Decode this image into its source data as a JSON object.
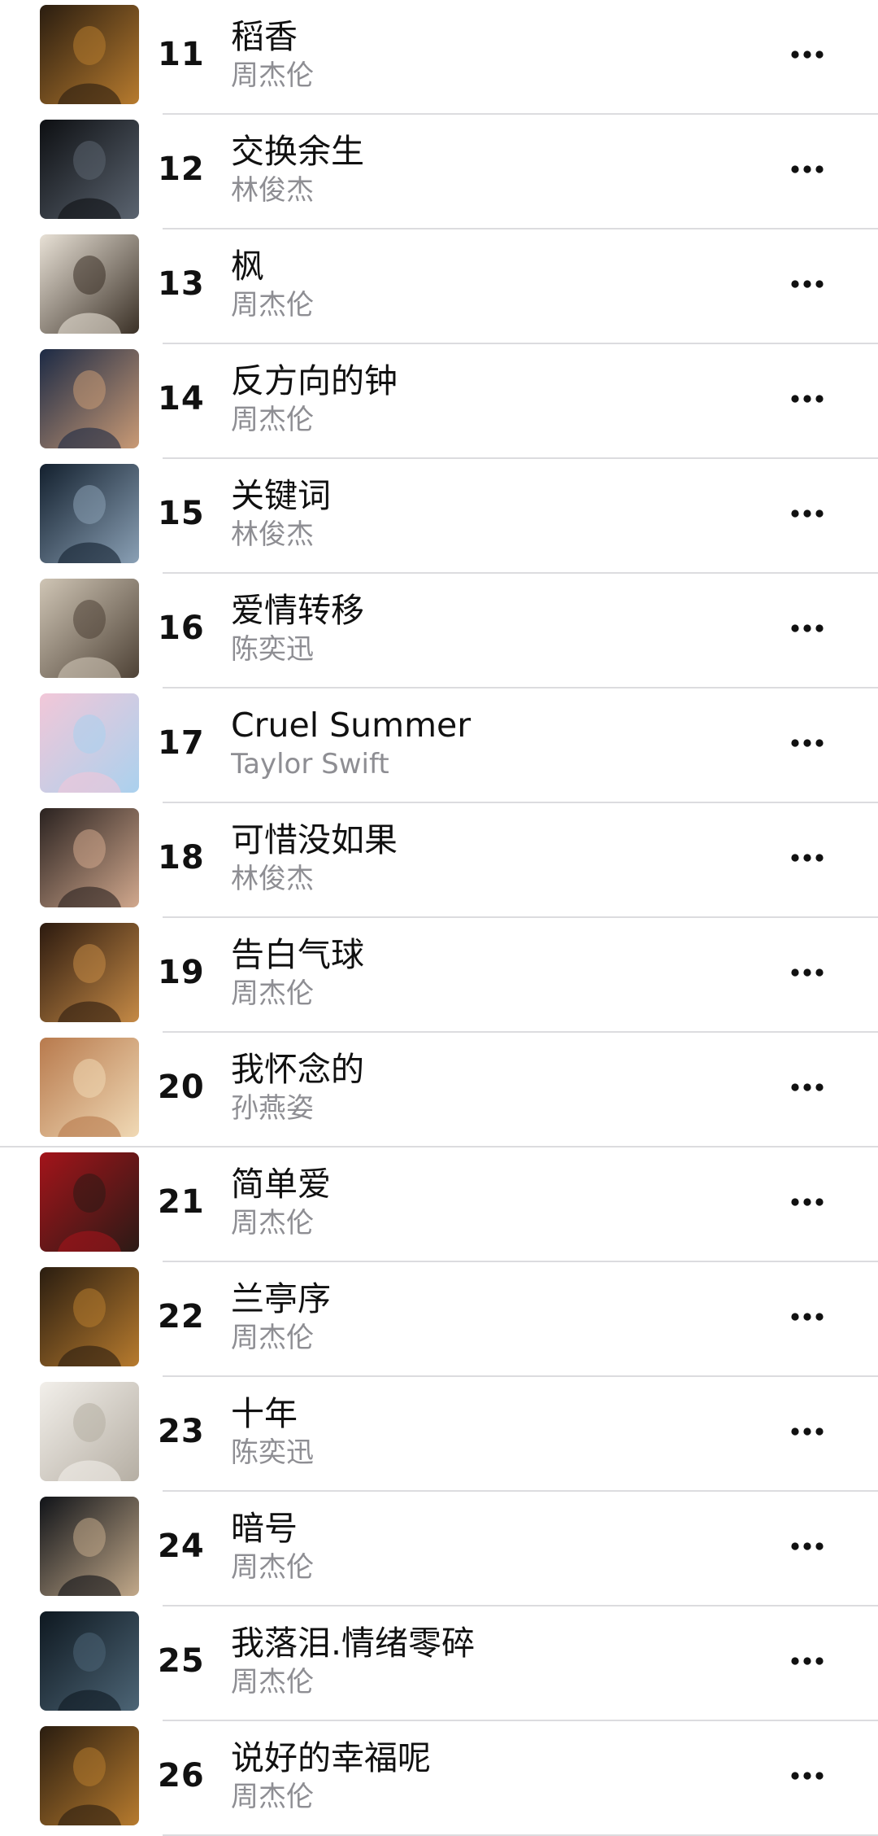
{
  "songs": [
    {
      "rank": "11",
      "title": "稻香",
      "artist": "周杰伦",
      "art_colors": [
        "#2a1d10",
        "#b77b2e"
      ]
    },
    {
      "rank": "12",
      "title": "交换余生",
      "artist": "林俊杰",
      "art_colors": [
        "#0d0f12",
        "#5b6470"
      ]
    },
    {
      "rank": "13",
      "title": "枫",
      "artist": "周杰伦",
      "art_colors": [
        "#e8e1d6",
        "#3a3026"
      ]
    },
    {
      "rank": "14",
      "title": "反方向的钟",
      "artist": "周杰伦",
      "art_colors": [
        "#1c2a45",
        "#c99a75"
      ]
    },
    {
      "rank": "15",
      "title": "关键词",
      "artist": "林俊杰",
      "art_colors": [
        "#13202e",
        "#8aa0b5"
      ]
    },
    {
      "rank": "16",
      "title": "爱情转移",
      "artist": "陈奕迅",
      "art_colors": [
        "#cfc5b5",
        "#4e4236"
      ]
    },
    {
      "rank": "17",
      "title": "Cruel Summer",
      "artist": "Taylor Swift",
      "art_colors": [
        "#f2c7d8",
        "#aad1ee"
      ]
    },
    {
      "rank": "18",
      "title": "可惜没如果",
      "artist": "林俊杰",
      "art_colors": [
        "#2a2220",
        "#d1a88d"
      ]
    },
    {
      "rank": "19",
      "title": "告白气球",
      "artist": "周杰伦",
      "art_colors": [
        "#2c1a0f",
        "#c58a46"
      ]
    },
    {
      "rank": "20",
      "title": "我怀念的",
      "artist": "孙燕姿",
      "art_colors": [
        "#b87a4d",
        "#f0d9b5"
      ]
    },
    {
      "rank": "21",
      "title": "简单爱",
      "artist": "周杰伦",
      "art_colors": [
        "#a3141a",
        "#2b1a16"
      ]
    },
    {
      "rank": "22",
      "title": "兰亭序",
      "artist": "周杰伦",
      "art_colors": [
        "#2a1d10",
        "#b77b2e"
      ]
    },
    {
      "rank": "23",
      "title": "十年",
      "artist": "陈奕迅",
      "art_colors": [
        "#f2efea",
        "#b5aea3"
      ]
    },
    {
      "rank": "24",
      "title": "暗号",
      "artist": "周杰伦",
      "art_colors": [
        "#101318",
        "#c2a98a"
      ]
    },
    {
      "rank": "25",
      "title": "我落泪.情绪零碎",
      "artist": "周杰伦",
      "art_colors": [
        "#0e1820",
        "#4d6576"
      ]
    },
    {
      "rank": "26",
      "title": "说好的幸福呢",
      "artist": "周杰伦",
      "art_colors": [
        "#2a1d10",
        "#b77b2e"
      ]
    }
  ],
  "colors": {
    "title_text": "#111111",
    "artist_text": "#8e8e93",
    "divider": "#dcdcdf",
    "more_icon": "#111111"
  },
  "icons": {
    "row_action": "more-horizontal-icon",
    "artwork": "album-artwork"
  }
}
